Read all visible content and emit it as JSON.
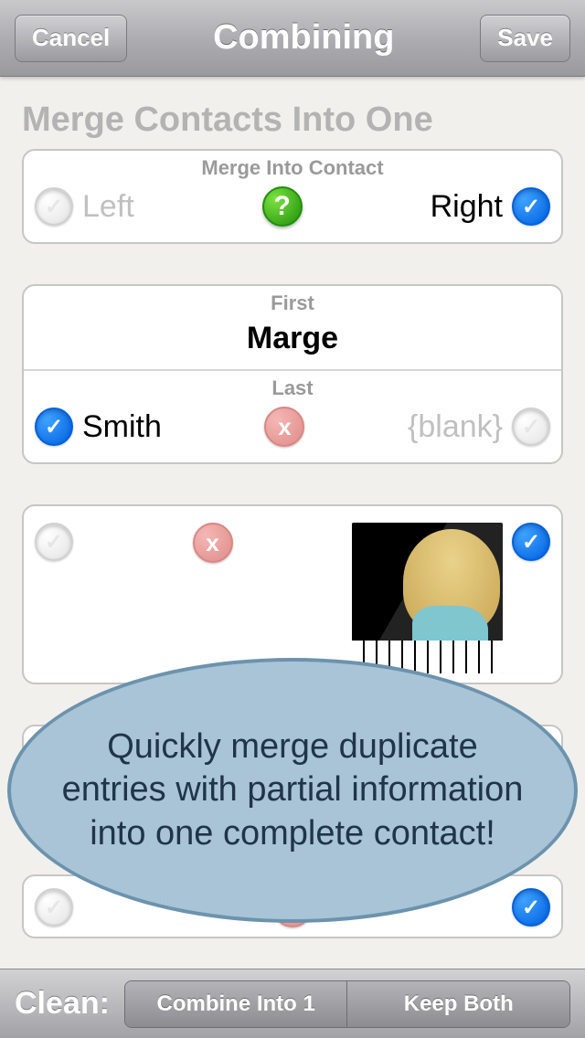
{
  "navbar": {
    "cancel": "Cancel",
    "title": "Combining",
    "save": "Save"
  },
  "section_title": "Merge Contacts Into One",
  "merge_into": {
    "header": "Merge Into Contact",
    "left": "Left",
    "right": "Right",
    "help": "?"
  },
  "name": {
    "first_label": "First",
    "first_value": "Marge",
    "last_label": "Last",
    "last_left": "Smith",
    "last_right": "{blank}",
    "x": "x"
  },
  "photo_row": {
    "x": "x"
  },
  "callout": "Quickly merge duplicate entries with partial information into one complete contact!",
  "toolbar": {
    "label": "Clean:",
    "combine": "Combine Into 1",
    "keep": "Keep Both"
  },
  "icons": {
    "check": "✓"
  }
}
